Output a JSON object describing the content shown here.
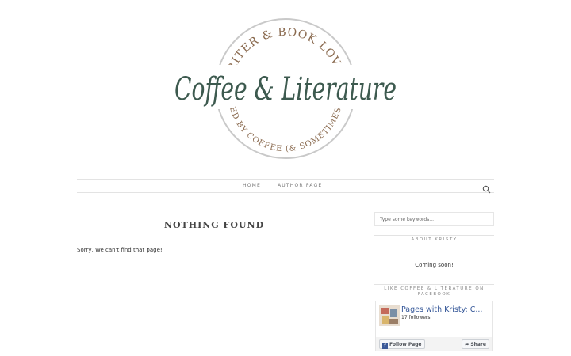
{
  "logo": {
    "top_text": "WRITER & BOOK LOVER",
    "main_text": "Coffee & Literature",
    "bottom_text": "FUELED BY COFFEE (& SOMETIMES TEA)"
  },
  "nav": {
    "items": [
      {
        "label": "HOME"
      },
      {
        "label": "AUTHOR PAGE"
      }
    ],
    "search_icon": "search-icon"
  },
  "main": {
    "title": "NOTHING FOUND",
    "message": "Sorry, We can't find that page!"
  },
  "sidebar": {
    "search_placeholder": "Type some keywords...",
    "about": {
      "title": "ABOUT KRISTY",
      "text": "Coming soon!"
    },
    "facebook": {
      "title": "LIKE COFFEE & LITERATURE ON FACEBOOK",
      "page_name": "Pages with Kristy: C...",
      "followers": "17 followers",
      "follow_label": "Follow Page",
      "share_label": "Share"
    }
  },
  "colors": {
    "logo_green": "#3d5a4f",
    "logo_brown": "#8a6a4f",
    "facebook_blue": "#3b5998"
  }
}
